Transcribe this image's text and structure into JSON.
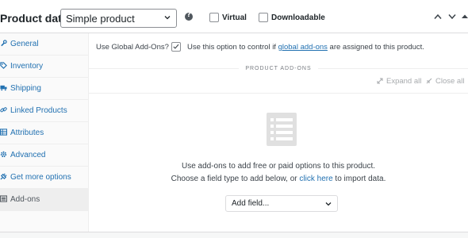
{
  "header": {
    "title": "Product data —",
    "product_type": "Simple product",
    "help_icon": "?",
    "virtual_label": "Virtual",
    "downloadable_label": "Downloadable"
  },
  "sidebar": {
    "items": [
      {
        "label": "General",
        "icon": "wrench-icon"
      },
      {
        "label": "Inventory",
        "icon": "tag-icon"
      },
      {
        "label": "Shipping",
        "icon": "truck-icon"
      },
      {
        "label": "Linked Products",
        "icon": "link-icon"
      },
      {
        "label": "Attributes",
        "icon": "table-icon"
      },
      {
        "label": "Advanced",
        "icon": "gear-icon"
      },
      {
        "label": "Get more options",
        "icon": "plugin-icon"
      },
      {
        "label": "Add-ons",
        "icon": "list-icon",
        "active": true
      }
    ]
  },
  "main": {
    "global_label": "Use Global Add-Ons?",
    "global_checked": true,
    "global_desc_before": "Use this option to control if ",
    "global_desc_link": "global add-ons",
    "global_desc_after": " are assigned to this product.",
    "section_title": "PRODUCT ADD-ONS",
    "expand_all": "Expand all",
    "close_all": "Close all",
    "empty_line1": "Use add-ons to add free or paid options to this product.",
    "empty_line2_before": "Choose a field type to add below, or ",
    "empty_line2_link": "click here",
    "empty_line2_after": " to import data.",
    "add_field": "Add field..."
  },
  "colors": {
    "link": "#2271b1",
    "active_bg": "#eeeeee",
    "text": "#1d2327"
  }
}
